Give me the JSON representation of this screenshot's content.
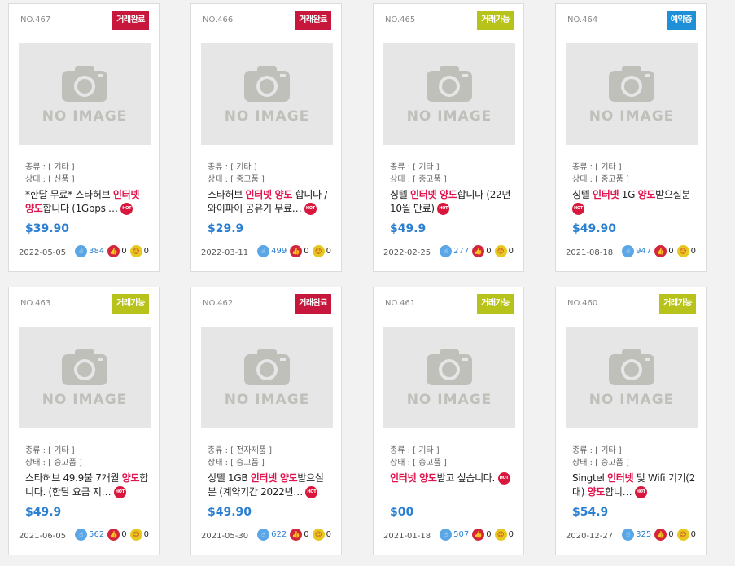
{
  "image_placeholder_text": "NO IMAGE",
  "meta_labels": {
    "type": "종류",
    "condition": "상태"
  },
  "cards": [
    {
      "no": "NO.467",
      "badge": "거래완료",
      "badge_kind": "done",
      "type": "[ 기타 ]",
      "condition": "[ 신품 ]",
      "title_parts": [
        "*한달 무료* 스타허브 ",
        "인터넷 양도",
        "합니다 (1Gbps …"
      ],
      "price": "$39.90",
      "date": "2022-05-05",
      "views": "384",
      "likes": "0",
      "emo": "0"
    },
    {
      "no": "NO.466",
      "badge": "거래완료",
      "badge_kind": "done",
      "type": "[ 기타 ]",
      "condition": "[ 중고품 ]",
      "title_parts": [
        "스타허브 ",
        "인터넷 양도",
        " 합니다 / 와이파이 공유기 무료…"
      ],
      "price": "$29.9",
      "date": "2022-03-11",
      "views": "499",
      "likes": "0",
      "emo": "0"
    },
    {
      "no": "NO.465",
      "badge": "거래가능",
      "badge_kind": "avail",
      "type": "[ 기타 ]",
      "condition": "[ 중고품 ]",
      "title_parts": [
        "싱텔 ",
        "인터넷 양도",
        "합니다 (22년 10월 만료)"
      ],
      "price": "$49.9",
      "date": "2022-02-25",
      "views": "277",
      "likes": "0",
      "emo": "0"
    },
    {
      "no": "NO.464",
      "badge": "예약중",
      "badge_kind": "resv",
      "type": "[ 기타 ]",
      "condition": "[ 중고품 ]",
      "title_parts": [
        "싱텔 ",
        "인터넷",
        " 1G ",
        "양도",
        "받으실분"
      ],
      "price": "$49.90",
      "date": "2021-08-18",
      "views": "947",
      "likes": "0",
      "emo": "0"
    },
    {
      "no": "NO.463",
      "badge": "거래가능",
      "badge_kind": "avail",
      "type": "[ 기타 ]",
      "condition": "[ 중고품 ]",
      "title_parts": [
        "스타허브 49.9불 7개월 ",
        "양도",
        "합니다. (한달 요금 지…"
      ],
      "price": "$49.9",
      "date": "2021-06-05",
      "views": "562",
      "likes": "0",
      "emo": "0"
    },
    {
      "no": "NO.462",
      "badge": "거래완료",
      "badge_kind": "done",
      "type": "[ 전자제품 ]",
      "condition": "[ 중고품 ]",
      "title_parts": [
        "싱텔 1GB ",
        "인터넷 양도",
        "받으실 분 (계약기간 2022년…"
      ],
      "price": "$49.90",
      "date": "2021-05-30",
      "views": "622",
      "likes": "0",
      "emo": "0"
    },
    {
      "no": "NO.461",
      "badge": "거래가능",
      "badge_kind": "avail",
      "type": "[ 기타 ]",
      "condition": "[ 중고품 ]",
      "title_parts": [
        "",
        "인터넷 양도",
        "받고 싶습니다."
      ],
      "price": "$00",
      "date": "2021-01-18",
      "views": "507",
      "likes": "0",
      "emo": "0"
    },
    {
      "no": "NO.460",
      "badge": "거래가능",
      "badge_kind": "avail",
      "type": "[ 기타 ]",
      "condition": "[ 중고품 ]",
      "title_parts": [
        "Singtel ",
        "인터넷",
        " 및 Wifi 기기(2대) ",
        "양도",
        "합니…"
      ],
      "price": "$54.9",
      "date": "2020-12-27",
      "views": "325",
      "likes": "0",
      "emo": "0"
    }
  ],
  "hot_label": "HOT",
  "colors": {
    "done": "#c8173c",
    "avail": "#b7c31a",
    "resv": "#1f8fd8",
    "price": "#2b7fd0",
    "highlight": "#e2144e"
  },
  "icons": {
    "views": "thumb-pointer-icon",
    "likes": "thumbs-up-icon",
    "emo": "smiley-icon"
  }
}
